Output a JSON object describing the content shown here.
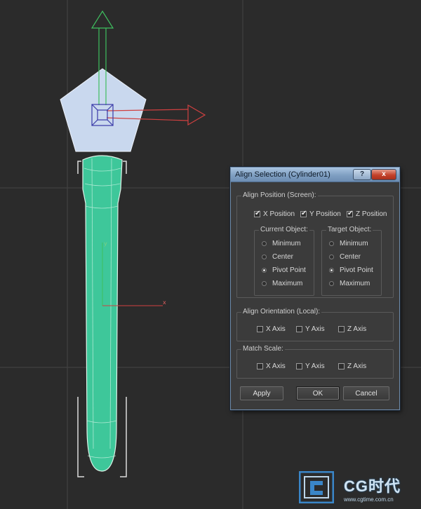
{
  "dialog": {
    "title": "Align Selection (Cylinder01)",
    "help_label": "?",
    "close_label": "x",
    "align_position": {
      "label": "Align Position (Screen):",
      "axes": [
        {
          "label": "X Position",
          "checked": true
        },
        {
          "label": "Y Position",
          "checked": true
        },
        {
          "label": "Z Position",
          "checked": true
        }
      ],
      "current_object": {
        "label": "Current Object:",
        "options": [
          "Minimum",
          "Center",
          "Pivot Point",
          "Maximum"
        ],
        "selected": "Pivot Point"
      },
      "target_object": {
        "label": "Target Object:",
        "options": [
          "Minimum",
          "Center",
          "Pivot Point",
          "Maximum"
        ],
        "selected": "Pivot Point"
      }
    },
    "align_orientation": {
      "label": "Align Orientation (Local):",
      "axes": [
        {
          "label": "X Axis",
          "checked": false
        },
        {
          "label": "Y Axis",
          "checked": false
        },
        {
          "label": "Z Axis",
          "checked": false
        }
      ]
    },
    "match_scale": {
      "label": "Match Scale:",
      "axes": [
        {
          "label": "X Axis",
          "checked": false
        },
        {
          "label": "Y Axis",
          "checked": false
        },
        {
          "label": "Z Axis",
          "checked": false
        }
      ]
    },
    "buttons": {
      "apply": "Apply",
      "ok": "OK",
      "cancel": "Cancel"
    }
  },
  "viewport": {
    "local_axis_labels": {
      "y": "y",
      "x": "x"
    },
    "colors": {
      "background": "#2b2b2b",
      "cylinder": "#3ec79a",
      "pentagon": "#c9d8ee",
      "gizmo_y": "#3fbf5f",
      "gizmo_x": "#d04040"
    }
  },
  "watermark": {
    "brand": "CG时代",
    "url": "www.cgtime.com.cn"
  }
}
